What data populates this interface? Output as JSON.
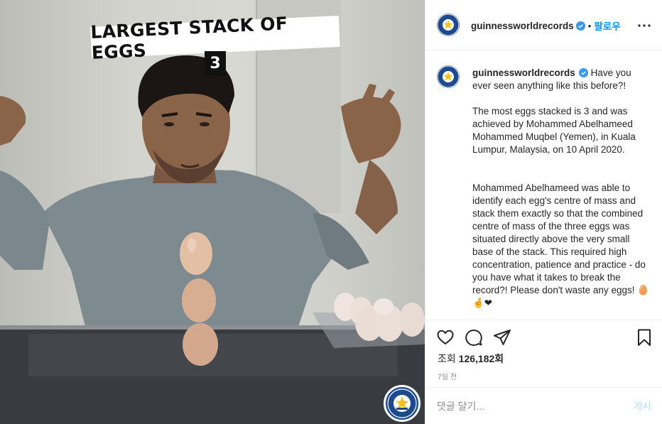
{
  "media": {
    "overlay_title": "LARGEST STACK OF EGGS",
    "overlay_count": "3",
    "badge_text": "GUINNESS WORLD RECORDS"
  },
  "header": {
    "username": "guinnessworldrecords",
    "separator": "•",
    "follow_label": "팔로우"
  },
  "caption": {
    "username": "guinnessworldrecords",
    "text": "Have you ever seen anything like this before?!\n\nThe most eggs stacked is 3 and was achieved by Mohammed Abelhameed Mohammed Muqbel (Yemen), in Kuala Lumpur, Malaysia, on 10 April 2020.\n\n\nMohammed Abelhameed was able to identify each egg's centre of mass and stack them exactly so that the combined centre of mass of the three eggs was situated directly above the very small base of the stack. This required high concentration, patience and practice - do you have what it takes to break the record?! Please don't waste any eggs! 🥚🤞❤"
  },
  "engagement": {
    "views_label": "조회",
    "views_count": "126,182회",
    "timestamp": "7일 전"
  },
  "comment": {
    "placeholder": "댓글 달기...",
    "post_label": "게시"
  },
  "colors": {
    "accent": "#0095f6",
    "post_disabled": "#b2dffc",
    "badge_blue": "#1d4a8f"
  }
}
